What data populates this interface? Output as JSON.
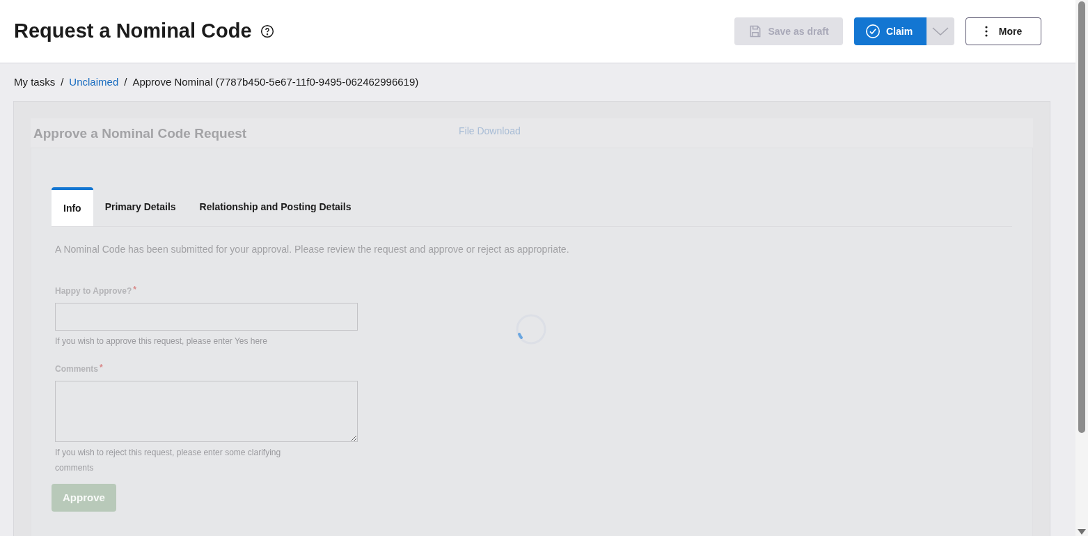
{
  "header": {
    "title": "Request a Nominal Code",
    "actions": [
      {
        "kind": "save",
        "label": "Save as draft",
        "disabled": true
      },
      {
        "kind": "claim",
        "label": "Claim",
        "disabled": false
      },
      {
        "kind": "more",
        "label": "More",
        "disabled": false
      }
    ]
  },
  "breadcrumb": [
    {
      "label": "My tasks",
      "link": false
    },
    {
      "separator": "/",
      "label": "Unclaimed",
      "link": true
    },
    {
      "separator": "/",
      "label": "Approve Nominal (7787b450-5e67-11f0-9495-062462996619)",
      "link": false
    }
  ],
  "form": {
    "title": "Approve a Nominal Code Request",
    "download_link": "File Download",
    "loading": true,
    "tabs": [
      {
        "label": "Info",
        "selected": true
      },
      {
        "label": "Primary Details",
        "selected": false
      },
      {
        "label": "Relationship and Posting Details",
        "selected": false
      }
    ],
    "description": "A Nominal Code has been submitted for your approval. Please review the request and approve or reject as appropriate.",
    "fields": [
      {
        "kind": "input",
        "label": "Happy to Approve?",
        "required": "*",
        "hint": "If you wish to approve this request, please enter Yes here"
      },
      {
        "kind": "textarea",
        "label": "Comments",
        "required": "*",
        "hint": "If you wish to reject this request, please enter some clarifying comments"
      }
    ],
    "submit": {
      "label": "Approve",
      "disabled": true
    }
  }
}
